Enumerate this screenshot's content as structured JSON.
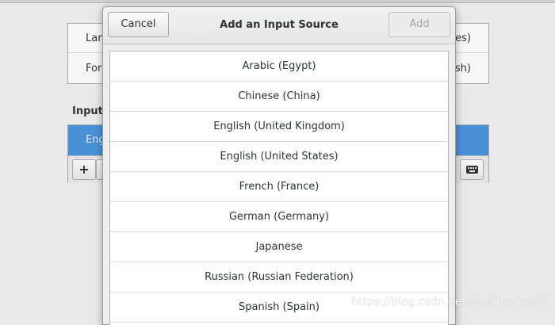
{
  "background": {
    "language_rows": [
      {
        "label": "Lan",
        "value": "es)"
      },
      {
        "label": "For",
        "value": "sh)"
      }
    ],
    "input_heading": "Input",
    "selected_source": "Eng",
    "toolbar": {
      "add_label": "+",
      "remove_label": ""
    }
  },
  "dialog": {
    "title": "Add an Input Source",
    "cancel_label": "Cancel",
    "add_label": "Add",
    "items": [
      "Arabic (Egypt)",
      "Chinese (China)",
      "English (United Kingdom)",
      "English (United States)",
      "French (France)",
      "German (Germany)",
      "Japanese",
      "Russian (Russian Federation)",
      "Spanish (Spain)"
    ]
  },
  "watermark": "https://blog.csdn.net/windowsworld",
  "colors": {
    "selection": "#4a90d9",
    "dialog_bg": "#ededed",
    "disabled_text": "#a3a6a6"
  },
  "icons": {
    "keyboard": "keyboard-icon"
  }
}
